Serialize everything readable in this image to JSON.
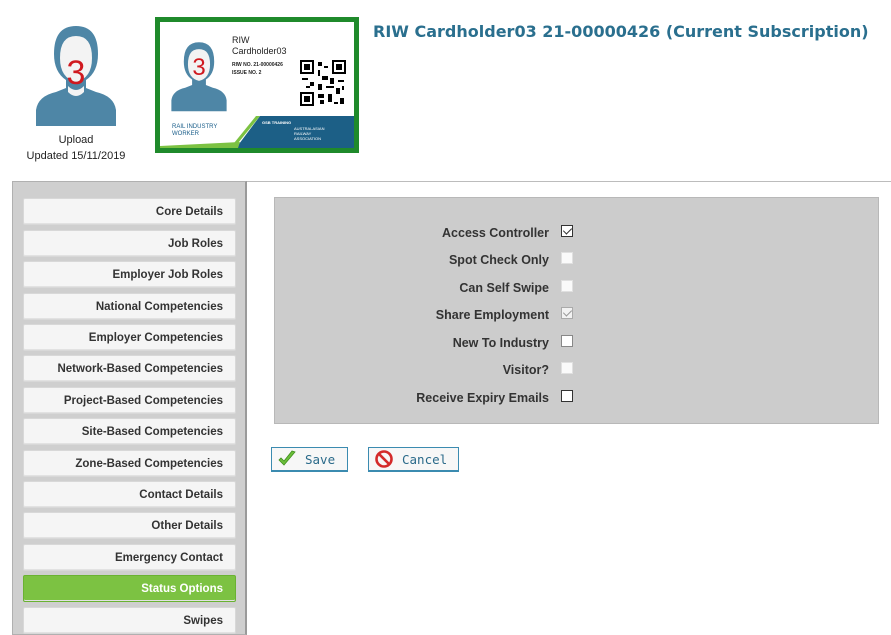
{
  "profile": {
    "avatar_number": "3",
    "upload_label": "Upload",
    "updated_text": "Updated 15/11/2019"
  },
  "card": {
    "avatar_number": "3",
    "name_line1": "RIW",
    "name_line2": "Cardholder03",
    "riw_no": "RIW NO.  21-00000426",
    "issue_no": "ISSUE NO. 2",
    "logo_text_line1": "RAIL INDUSTRY",
    "logo_text_line2": "WORKER",
    "band_text": "GSB TRAINING",
    "assoc_line1": "AUSTRALASIAN",
    "assoc_line2": "RAILWAY",
    "assoc_line3": "ASSOCIATION",
    "border_color": "#1f8a2b"
  },
  "header": {
    "title": "RIW Cardholder03 21-00000426 (Current Subscription)"
  },
  "sidebar": {
    "items": [
      {
        "label": "Core Details",
        "active": false
      },
      {
        "label": "Job Roles",
        "active": false
      },
      {
        "label": "Employer Job Roles",
        "active": false
      },
      {
        "label": "National Competencies",
        "active": false
      },
      {
        "label": "Employer Competencies",
        "active": false
      },
      {
        "label": "Network-Based Competencies",
        "active": false
      },
      {
        "label": "Project-Based Competencies",
        "active": false
      },
      {
        "label": "Site-Based Competencies",
        "active": false
      },
      {
        "label": "Zone-Based Competencies",
        "active": false
      },
      {
        "label": "Contact Details",
        "active": false
      },
      {
        "label": "Other Details",
        "active": false
      },
      {
        "label": "Emergency Contact",
        "active": false
      },
      {
        "label": "Status Options",
        "active": true
      },
      {
        "label": "Swipes",
        "active": false
      }
    ],
    "active_color": "#7cc242"
  },
  "options": [
    {
      "label": "Access Controller",
      "checked": true,
      "enabled": true
    },
    {
      "label": "Spot Check Only",
      "checked": false,
      "enabled": false
    },
    {
      "label": "Can Self Swipe",
      "checked": false,
      "enabled": false
    },
    {
      "label": "Share Employment",
      "checked": true,
      "enabled": false
    },
    {
      "label": "New To Industry",
      "checked": false,
      "enabled": true
    },
    {
      "label": "Visitor?",
      "checked": false,
      "enabled": false
    },
    {
      "label": "Receive Expiry Emails",
      "checked": false,
      "enabled": true
    }
  ],
  "actions": {
    "save_label": "Save",
    "save_icon": "checkmark-icon",
    "cancel_label": "Cancel",
    "cancel_icon": "no-entry-icon"
  }
}
